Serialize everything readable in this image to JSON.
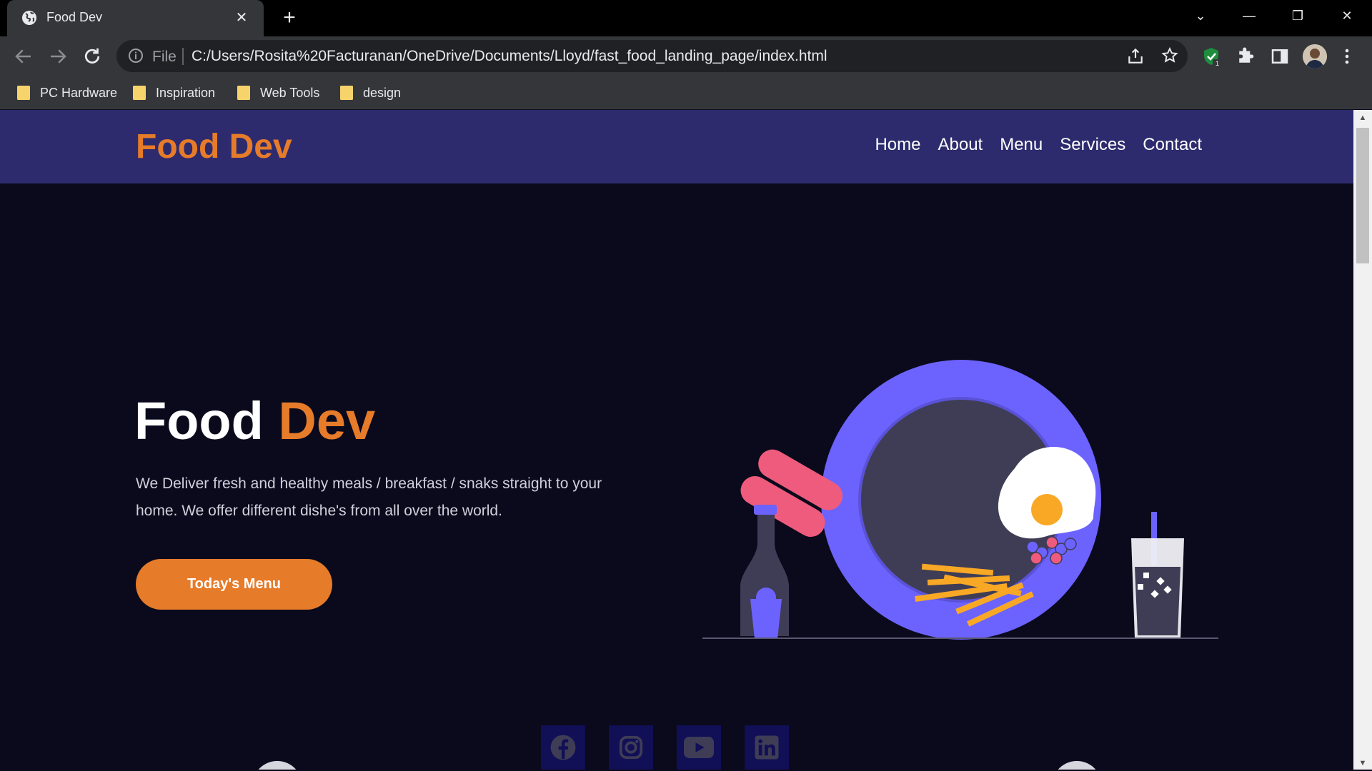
{
  "browser": {
    "tab_title": "Food Dev",
    "address_scheme": "File",
    "address_url": "C:/Users/Rosita%20Facturanan/OneDrive/Documents/Lloyd/fast_food_landing_page/index.html",
    "extension_badge": "1",
    "bookmarks": [
      {
        "label": "PC Hardware"
      },
      {
        "label": "Inspiration"
      },
      {
        "label": "Web Tools"
      },
      {
        "label": "design"
      }
    ]
  },
  "site": {
    "logo": "Food Dev",
    "nav": [
      "Home",
      "About",
      "Menu",
      "Services",
      "Contact"
    ]
  },
  "hero": {
    "title_main": "Food",
    "title_accent": "Dev",
    "description": "We Deliver fresh and healthy meals / breakfast / snaks straight to your home. We offer different dishe's from all over the world.",
    "cta": "Today's Menu"
  },
  "socials": [
    "facebook-icon",
    "instagram-icon",
    "youtube-icon",
    "linkedin-icon"
  ],
  "colors": {
    "accent": "#e67b2a",
    "header_bg": "#2d2b6e",
    "page_bg": "#0b0a1c",
    "plate": "#6c63ff"
  }
}
